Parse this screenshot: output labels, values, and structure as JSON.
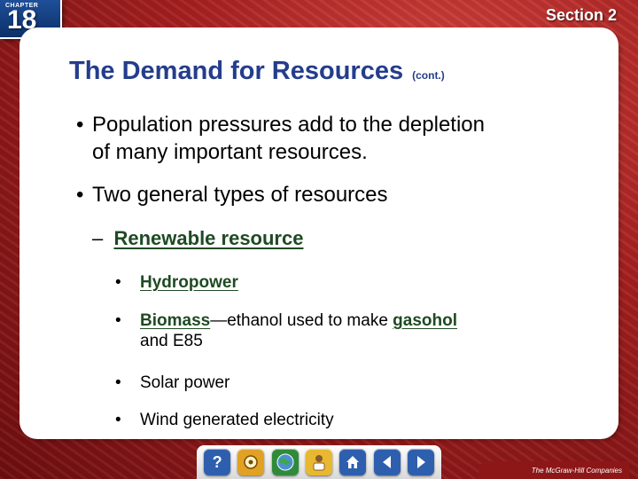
{
  "header": {
    "chapter_word": "CHAPTER",
    "chapter_number": "18",
    "section": "Section 2"
  },
  "slide": {
    "title": "The Demand for Resources",
    "title_suffix": "(cont.)",
    "bullets": [
      {
        "line1": "Population pressures add to the depletion",
        "line2": "of many important resources."
      },
      {
        "line1": "Two general types of resources"
      }
    ],
    "subheading": {
      "dash": "–",
      "term": "Renewable resource"
    },
    "items": [
      {
        "term": "Hydropower"
      },
      {
        "term": "Biomass",
        "text1": "—ethanol used to make ",
        "term2": "gasohol",
        "line2": "and E85"
      },
      {
        "text": "Solar power"
      },
      {
        "text": "Wind generated electricity"
      }
    ]
  },
  "nav": {
    "buttons": [
      {
        "name": "help",
        "label": "?",
        "color": "#2e5fae"
      },
      {
        "name": "resources",
        "label": "",
        "color": "#e0a125"
      },
      {
        "name": "web",
        "label": "",
        "color": "#2f8a3a"
      },
      {
        "name": "teacher",
        "label": "",
        "color": "#e8b830"
      },
      {
        "name": "home",
        "label": "",
        "color": "#2e5fae"
      },
      {
        "name": "previous",
        "label": "",
        "color": "#2e5fae"
      },
      {
        "name": "next",
        "label": "",
        "color": "#2e5fae"
      }
    ]
  },
  "footer": {
    "publisher": "The McGraw-Hill Companies"
  },
  "colors": {
    "title": "#243d8c",
    "term": "#1f4a23",
    "background_red": "#a51f1f"
  }
}
